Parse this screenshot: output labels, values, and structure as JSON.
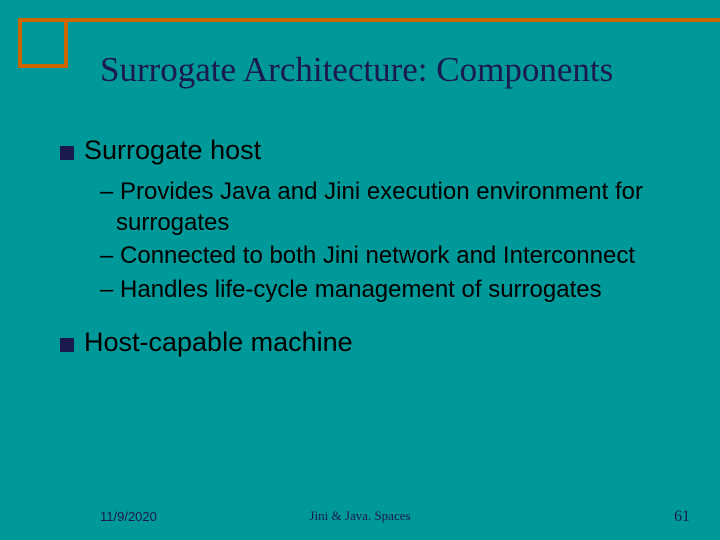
{
  "title": "Surrogate Architecture: Components",
  "bullets": [
    {
      "text": "Surrogate host",
      "sub": [
        "– Provides Java and Jini execution environment for surrogates",
        "– Connected to both Jini network and Interconnect",
        "– Handles life-cycle management of surrogates"
      ]
    },
    {
      "text": "Host-capable machine",
      "sub": []
    }
  ],
  "footer": {
    "date": "11/9/2020",
    "center": "Jini  &  Java. Spaces",
    "page": "61"
  }
}
